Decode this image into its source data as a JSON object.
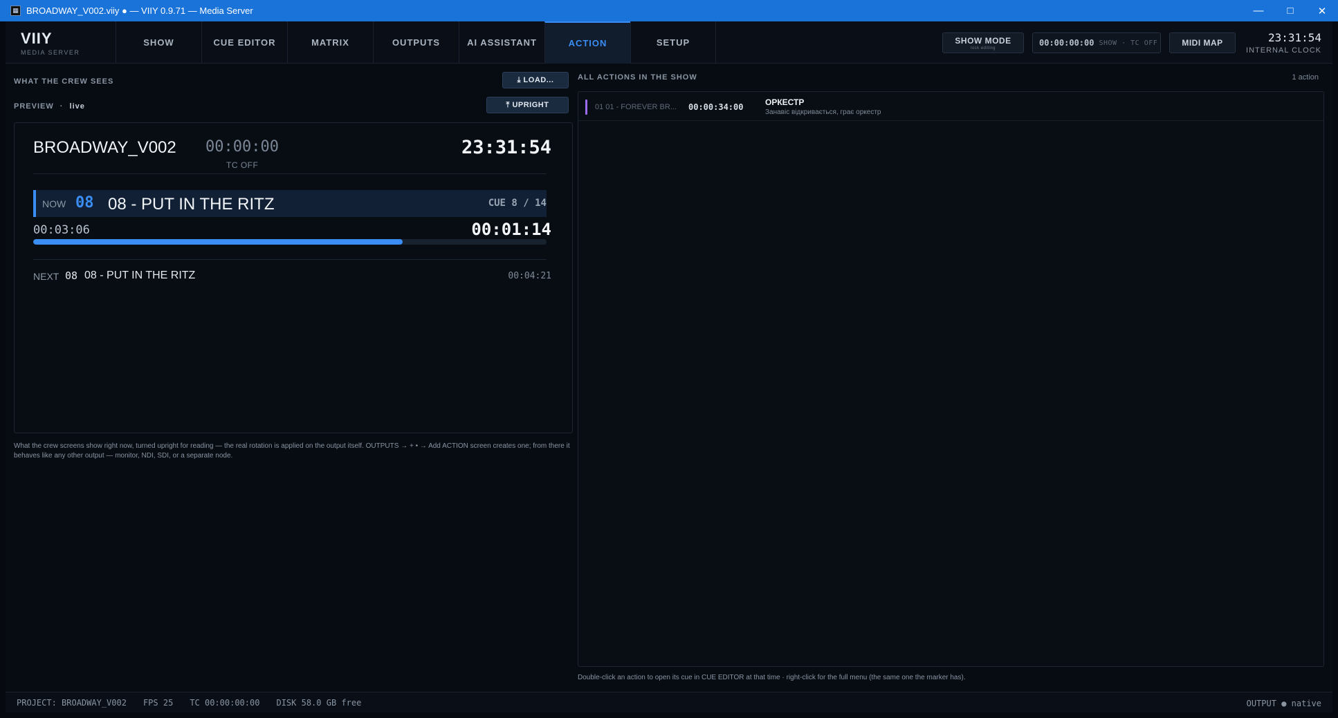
{
  "window": {
    "title": "BROADWAY_V002.viiy  ●  —  VIIY 0.9.71 — Media Server",
    "minimize": "—",
    "maximize": "□",
    "close": "✕"
  },
  "brand": {
    "name": "VIIY",
    "sub": "MEDIA SERVER"
  },
  "tabs": [
    {
      "label": "SHOW"
    },
    {
      "label": "CUE EDITOR"
    },
    {
      "label": "MATRIX"
    },
    {
      "label": "OUTPUTS"
    },
    {
      "label": "AI ASSISTANT"
    },
    {
      "label": "ACTION"
    },
    {
      "label": "SETUP"
    }
  ],
  "header": {
    "show_mode": "SHOW MODE",
    "show_mode_sub": "lock editing",
    "timecode": "00:00:00:00",
    "timecode_label": "SHOW · TC OFF",
    "midi_map": "MIDI MAP",
    "clock": "23:31:54",
    "clock_label": "INTERNAL CLOCK"
  },
  "left": {
    "title": "WHAT THE CREW SEES",
    "load_button": "⤓ LOAD...",
    "preview_label": "PREVIEW",
    "preview_sep": "·",
    "preview_state": "live",
    "upright_button": "⤒ UPRIGHT",
    "help": "What the crew screens show right now, turned upright for reading — the real rotation is applied on the output itself. OUTPUTS → + • → Add ACTION screen creates one; from there it behaves like any other output — monitor, NDI, SDI, or a separate node."
  },
  "preview": {
    "project": "BROADWAY_V002",
    "timecode": "00:00:00",
    "tc_status": "TC OFF",
    "clock": "23:31:54",
    "now_label": "NOW",
    "now_number": "08",
    "now_title": "08 - PUT IN THE RITZ",
    "cue_position": "CUE  8 / 14",
    "elapsed": "00:03:06",
    "remaining": "00:01:14",
    "progress_fraction": 0.72,
    "next_label": "NEXT",
    "next_number": "08",
    "next_title": "08 - PUT IN THE RITZ",
    "next_duration": "00:04:21"
  },
  "actions": {
    "title": "ALL ACTIONS IN THE SHOW",
    "count": "1 action",
    "marker_color": "#9b6cf0",
    "items": [
      {
        "cue": "01  01 - FOREVER BR...",
        "time": "00:00:34:00",
        "name": "ОРКЕСТР",
        "description": "Занавіс відкривається, грає оркестр"
      }
    ],
    "help": "Double-click an action to open its cue in CUE EDITOR at that time  ·  right-click for the full menu (the same one the marker has)."
  },
  "status": {
    "project": "PROJECT: BROADWAY_V002",
    "fps": "FPS 25",
    "tc": "TC 00:00:00:00",
    "disk": "DISK 58.0 GB free",
    "output": "OUTPUT ● native"
  },
  "colors": {
    "accent": "#3a8df2",
    "titlebar": "#1a73d9",
    "action_marker": "#9b6cf0"
  }
}
